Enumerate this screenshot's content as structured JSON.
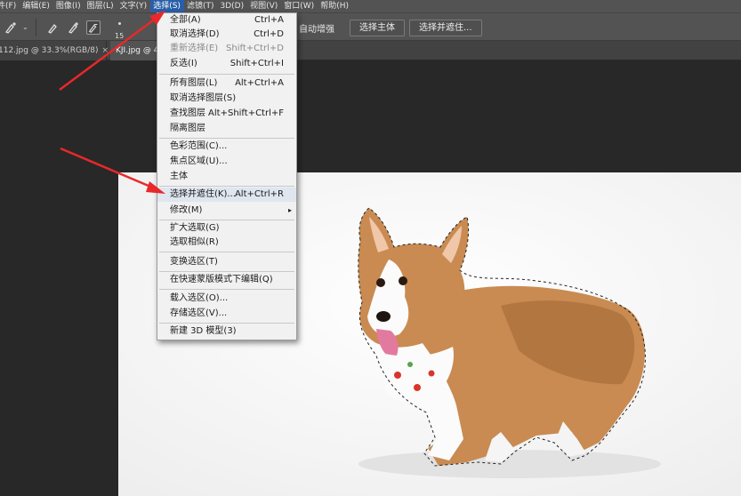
{
  "menubar": {
    "items": [
      {
        "label": "件(F)"
      },
      {
        "label": "编辑(E)"
      },
      {
        "label": "图像(I)"
      },
      {
        "label": "图层(L)"
      },
      {
        "label": "文字(Y)"
      },
      {
        "label": "选择(S)",
        "active": true
      },
      {
        "label": "滤镜(T)"
      },
      {
        "label": "3D(D)"
      },
      {
        "label": "视图(V)"
      },
      {
        "label": "窗口(W)"
      },
      {
        "label": "帮助(H)"
      }
    ]
  },
  "options_bar": {
    "brush_size": "15",
    "auto_enhance_label": "自动增强",
    "select_subject_label": "选择主体",
    "select_and_mask_label": "选择并遮住..."
  },
  "tabs": [
    {
      "label": "112.jpg @ 33.3%(RGB/8)",
      "close": "×"
    },
    {
      "label": "KJI.jpg @ 4"
    }
  ],
  "select_menu": {
    "items": [
      {
        "label": "全部(A)",
        "shortcut": "Ctrl+A"
      },
      {
        "label": "取消选择(D)",
        "shortcut": "Ctrl+D"
      },
      {
        "label": "重新选择(E)",
        "shortcut": "Shift+Ctrl+D",
        "disabled": true
      },
      {
        "label": "反选(I)",
        "shortcut": "Shift+Ctrl+I"
      },
      {
        "label": "所有图层(L)",
        "shortcut": "Alt+Ctrl+A"
      },
      {
        "label": "取消选择图层(S)",
        "shortcut": ""
      },
      {
        "label": "查找图层",
        "shortcut": "Alt+Shift+Ctrl+F"
      },
      {
        "label": "隔离图层",
        "shortcut": ""
      },
      {
        "label": "色彩范围(C)...",
        "shortcut": ""
      },
      {
        "label": "焦点区域(U)...",
        "shortcut": ""
      },
      {
        "label": "主体",
        "shortcut": ""
      },
      {
        "label": "选择并遮住(K)...",
        "shortcut": "Alt+Ctrl+R",
        "hover": true
      },
      {
        "label": "修改(M)",
        "shortcut": "",
        "submenu": true
      },
      {
        "label": "扩大选取(G)",
        "shortcut": ""
      },
      {
        "label": "选取相似(R)",
        "shortcut": ""
      },
      {
        "label": "变换选区(T)",
        "shortcut": ""
      },
      {
        "label": "在快速蒙版模式下编辑(Q)",
        "shortcut": ""
      },
      {
        "label": "载入选区(O)...",
        "shortcut": ""
      },
      {
        "label": "存储选区(V)...",
        "shortcut": ""
      },
      {
        "label": "新建 3D 模型(3)",
        "shortcut": ""
      }
    ],
    "submenu_arrow": "▸"
  },
  "icons": {
    "brush": "brush-icon",
    "brush_plus": "brush-add-icon",
    "brush_minus": "brush-subtract-icon",
    "caret": "chevron-down-icon"
  },
  "colors": {
    "menubar_bg": "#535353",
    "menu_active": "#2a5ea8",
    "dropdown_bg": "#f1f1f1",
    "workspace": "#282828",
    "canvas": "#f7f7f7",
    "arrow": "#e8282a"
  }
}
